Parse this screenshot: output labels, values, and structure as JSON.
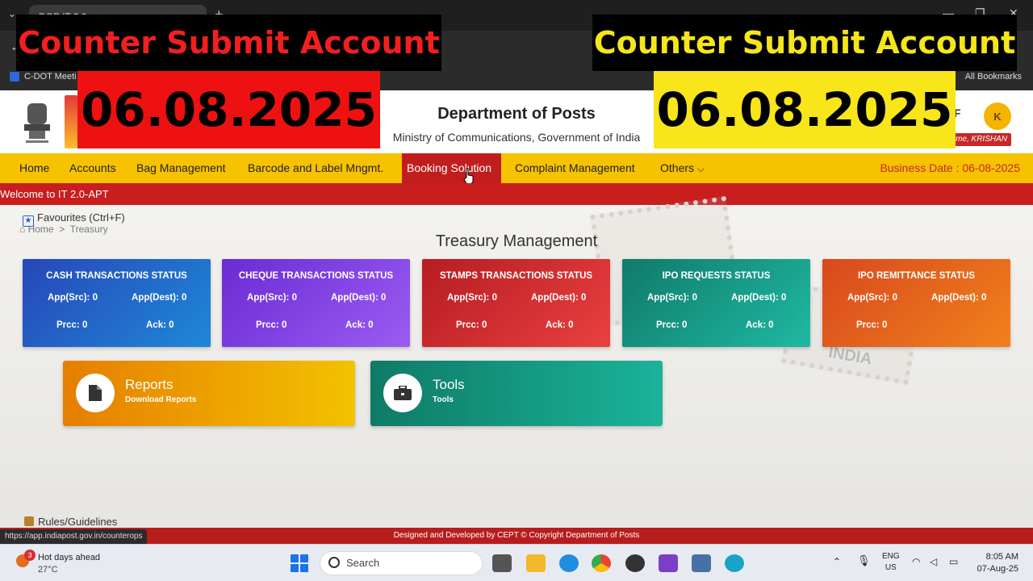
{
  "browser": {
    "tab_title": "DOP IT 2.0",
    "bookmark_item": "C-DOT Meeti",
    "all_bookmarks": "All Bookmarks"
  },
  "overlay": {
    "title": "Counter Submit Account",
    "date": "06.08.2025",
    "colors": {
      "left_title": "#f21f1f",
      "left_date_bg": "#ee1111",
      "right_title": "#f5e51b",
      "right_date_bg": "#f8e51a"
    }
  },
  "header": {
    "title": "Department of Posts",
    "subtitle": "Ministry of Communications, Government of India",
    "fragment": "F",
    "avatar_letter": "K",
    "welcome_user": "me, KRISHAN"
  },
  "nav": {
    "items": [
      "Home",
      "Accounts",
      "Bag Management",
      "Barcode and Label Mngmt.",
      "Booking Solution",
      "Complaint Management",
      "Others"
    ],
    "active": "Booking Solution",
    "business_date": "Business Date : 06-08-2025"
  },
  "ticker": "Welcome to IT 2.0-APT",
  "favourites": "Favourites (Ctrl+F)",
  "breadcrumb": {
    "home": "Home",
    "sep": ">",
    "current": "Treasury"
  },
  "page_title": "Treasury Management",
  "stamp_text": "INDIA",
  "cards": [
    {
      "title": "CASH TRANSACTIONS STATUS",
      "app_src": "App(Src): 0",
      "app_dest": "App(Dest): 0",
      "prcc": "Prcc: 0",
      "ack": "Ack: 0"
    },
    {
      "title": "CHEQUE TRANSACTIONS STATUS",
      "app_src": "App(Src): 0",
      "app_dest": "App(Dest): 0",
      "prcc": "Prcc: 0",
      "ack": "Ack: 0"
    },
    {
      "title": "STAMPS TRANSACTIONS STATUS",
      "app_src": "App(Src): 0",
      "app_dest": "App(Dest): 0",
      "prcc": "Prcc: 0",
      "ack": "Ack: 0"
    },
    {
      "title": "IPO REQUESTS STATUS",
      "app_src": "App(Src): 0",
      "app_dest": "App(Dest): 0",
      "prcc": "Prcc: 0",
      "ack": "Ack: 0"
    },
    {
      "title": "IPO REMITTANCE STATUS",
      "app_src": "App(Src): 0",
      "app_dest": "App(Dest): 0",
      "prcc": "Prcc: 0"
    }
  ],
  "tiles": {
    "reports": {
      "title": "Reports",
      "subtitle": "Download Reports"
    },
    "tools": {
      "title": "Tools",
      "subtitle": "Tools"
    }
  },
  "rules": "Rules/Guidelines",
  "footer": "Designed and Developed by CEPT © Copyright Department of Posts",
  "status_url": "https://app.indiapost.gov.in/counterops",
  "taskbar": {
    "weather_title": "Hot days ahead",
    "weather_temp": "27°C",
    "weather_badge": "3",
    "search_placeholder": "Search",
    "lang": "ENG",
    "region": "US",
    "time": "8:05 AM",
    "date": "07-Aug-25"
  }
}
